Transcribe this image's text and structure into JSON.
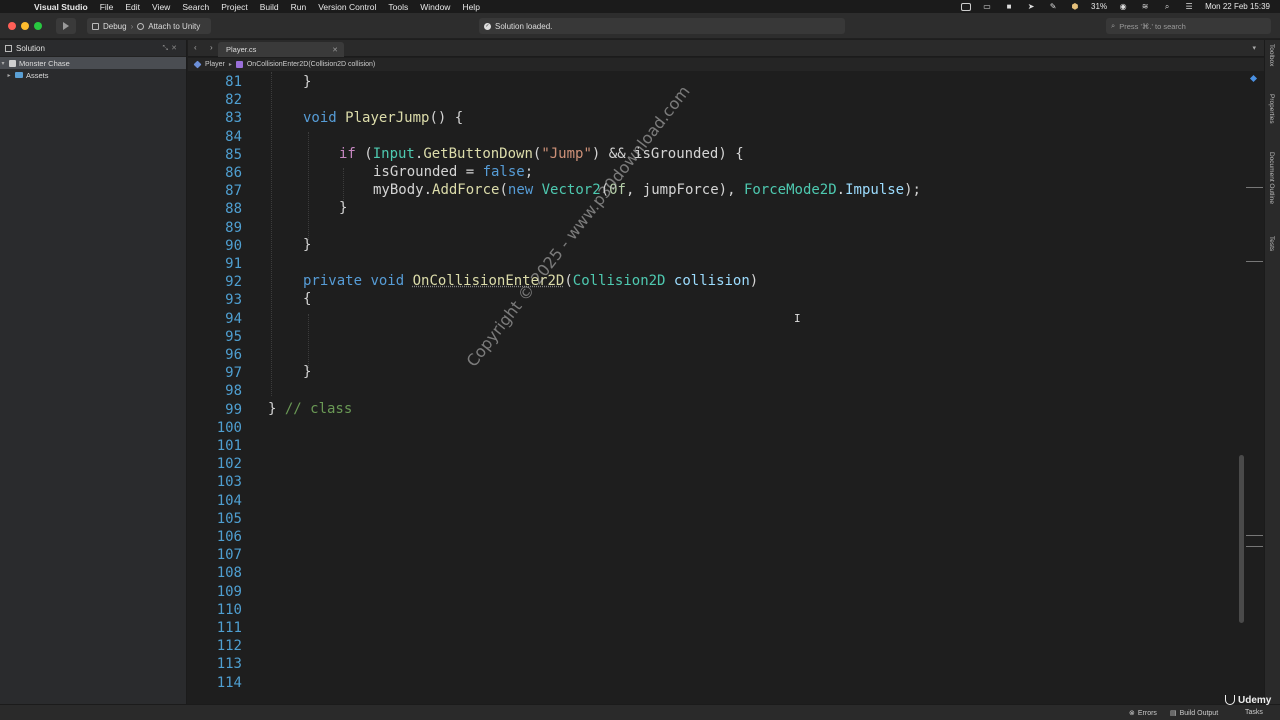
{
  "menubar": {
    "app_name": "Visual Studio",
    "items": [
      "File",
      "Edit",
      "View",
      "Search",
      "Project",
      "Build",
      "Run",
      "Version Control",
      "Tools",
      "Window",
      "Help"
    ],
    "battery": "31%",
    "clock": "Mon 22 Feb  15:39"
  },
  "toolbar": {
    "configuration": "Debug",
    "target": "Attach to Unity",
    "status": "Solution loaded.",
    "search_placeholder": "Press '⌘.' to search"
  },
  "solution_pad": {
    "title": "Solution",
    "items": [
      {
        "label": "Monster Chase",
        "selected": true
      },
      {
        "label": "Assets",
        "selected": false
      }
    ]
  },
  "editor": {
    "tab_label": "Player.cs",
    "breadcrumb_class": "Player",
    "breadcrumb_method": "OnCollisionEnter2D(Collision2D collision)",
    "lines": [
      {
        "n": "81"
      },
      {
        "n": "82"
      },
      {
        "n": "83"
      },
      {
        "n": "84"
      },
      {
        "n": "85"
      },
      {
        "n": "86"
      },
      {
        "n": "87"
      },
      {
        "n": "88"
      },
      {
        "n": "89"
      },
      {
        "n": "90"
      },
      {
        "n": "91"
      },
      {
        "n": "92"
      },
      {
        "n": "93"
      },
      {
        "n": "94"
      },
      {
        "n": "95"
      },
      {
        "n": "96"
      },
      {
        "n": "97"
      },
      {
        "n": "98"
      },
      {
        "n": "99"
      },
      {
        "n": "100"
      },
      {
        "n": "101"
      },
      {
        "n": "102"
      },
      {
        "n": "103"
      },
      {
        "n": "104"
      },
      {
        "n": "105"
      },
      {
        "n": "106"
      },
      {
        "n": "107"
      },
      {
        "n": "108"
      },
      {
        "n": "109"
      },
      {
        "n": "110"
      },
      {
        "n": "111"
      },
      {
        "n": "112"
      },
      {
        "n": "113"
      },
      {
        "n": "114"
      }
    ],
    "code": {
      "l81": "}",
      "l83_kw": "void",
      "l83_fn": "PlayerJump",
      "l83_rest": "() {",
      "l85_kw": "if",
      "l85_p1": " (",
      "l85_ty": "Input",
      "l85_dot": ".",
      "l85_fn": "GetButtonDown",
      "l85_p2": "(",
      "l85_str": "\"Jump\"",
      "l85_p3": ") && isGrounded) {",
      "l86_a": "isGrounded = ",
      "l86_kw": "false",
      "l86_b": ";",
      "l87_a": "myBody.",
      "l87_fn": "AddForce",
      "l87_b": "(",
      "l87_kw": "new",
      "l87_c": " ",
      "l87_ty": "Vector2",
      "l87_d": "(",
      "l87_num": "0f",
      "l87_e": ", jumpForce), ",
      "l87_ty2": "ForceMode2D",
      "l87_f": ".",
      "l87_vr": "Impulse",
      "l87_g": ");",
      "l88": "}",
      "l90": "}",
      "l92_kw1": "private",
      "l92_sp": " ",
      "l92_kw2": "void",
      "l92_sp2": " ",
      "l92_fn": "OnCollisionEnter2D",
      "l92_p": "(",
      "l92_ty": "Collision2D",
      "l92_sp3": " ",
      "l92_vr": "collision",
      "l92_e": ")",
      "l93": "{",
      "l97": "}",
      "l99_a": "} ",
      "l99_cm": "// class"
    }
  },
  "watermark": "Copyright © 2025 - www.p30download.com",
  "right_pads": [
    "Toolbox",
    "Properties",
    "Document Outline",
    "Tests"
  ],
  "statusbar": {
    "errors": "Errors",
    "build_output": "Build Output",
    "tasks": "Tasks",
    "udemy": "Udemy"
  },
  "colors": {
    "line_number": "#4f9fd1",
    "keyword": "#569cd6",
    "control_keyword": "#c586c0",
    "function": "#dcdcaa",
    "type": "#4ec9b0",
    "string": "#ce9178",
    "comment": "#6a9955"
  }
}
